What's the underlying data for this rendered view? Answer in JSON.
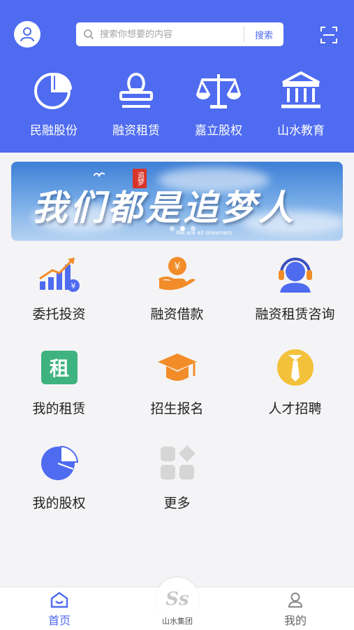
{
  "search": {
    "placeholder": "搜索你想要的内容",
    "button": "搜索"
  },
  "top_nav": [
    {
      "label": "民融股份",
      "icon": "pie-chart-icon"
    },
    {
      "label": "融资租赁",
      "icon": "stamp-icon"
    },
    {
      "label": "嘉立股权",
      "icon": "scales-icon"
    },
    {
      "label": "山水教育",
      "icon": "institution-icon"
    }
  ],
  "banner": {
    "title": "我们都是追梦人",
    "seal": "追梦",
    "subtitle": "We are all dreamers",
    "active_slide": 2,
    "slide_count": 3
  },
  "grid": [
    {
      "label": "委托投资",
      "icon": "investment-growth-icon"
    },
    {
      "label": "融资借款",
      "icon": "loan-coin-hand-icon"
    },
    {
      "label": "融资租赁咨询",
      "icon": "customer-service-icon"
    },
    {
      "label": "我的租赁",
      "icon": "lease-badge-icon"
    },
    {
      "label": "招生报名",
      "icon": "graduation-cap-icon"
    },
    {
      "label": "人才招聘",
      "icon": "tie-icon"
    },
    {
      "label": "我的股权",
      "icon": "equity-pie-icon"
    },
    {
      "label": "更多",
      "icon": "more-grid-icon"
    }
  ],
  "lease_badge_char": "租",
  "tabbar": {
    "home": "首页",
    "center": "山水集团",
    "center_logo": "Ss",
    "mine": "我的",
    "active": "home"
  },
  "colors": {
    "primary": "#4f6bf0",
    "orange": "#f28c28",
    "green": "#3fb37f",
    "yellow": "#f3c13a"
  }
}
